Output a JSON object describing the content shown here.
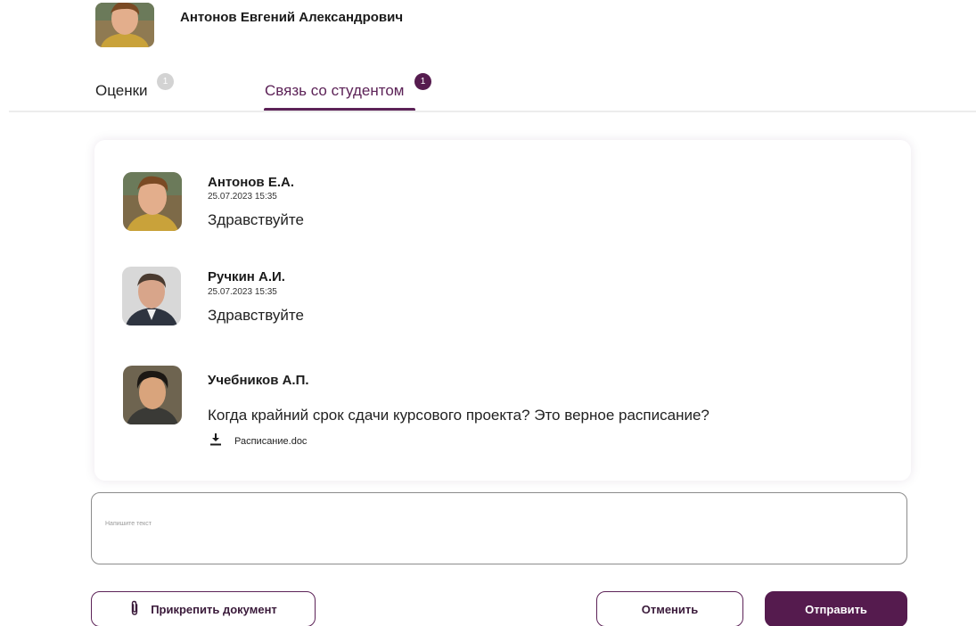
{
  "header": {
    "student_name": "Антонов Евгений Александрович"
  },
  "tabs": [
    {
      "label": "Оценки",
      "badge": "1",
      "active": false
    },
    {
      "label": "Связь со студентом",
      "badge": "1",
      "active": true
    }
  ],
  "messages": [
    {
      "author": "Антонов Е.А.",
      "time": "25.07.2023 15:35",
      "text": "Здравствуйте"
    },
    {
      "author": "Ручкин А.И.",
      "time": "25.07.2023 15:35",
      "text": "Здравствуйте"
    },
    {
      "author": "Учебников А.П.",
      "time": "",
      "text": "Когда крайний срок сдачи курсового проекта? Это верное расписание?",
      "attachment": "Расписание.doc"
    }
  ],
  "composer": {
    "placeholder": "Напишите текст",
    "value": ""
  },
  "actions": {
    "attach_label": "Прикрепить документ",
    "cancel_label": "Отменить",
    "send_label": "Отправить"
  },
  "icons": {
    "attach": "paperclip-icon",
    "attachment": "download-icon"
  },
  "colors": {
    "accent": "#5c2257",
    "accent_dark": "#551b4e",
    "badge_inactive": "#d3d3d3",
    "divider": "#ececec"
  }
}
